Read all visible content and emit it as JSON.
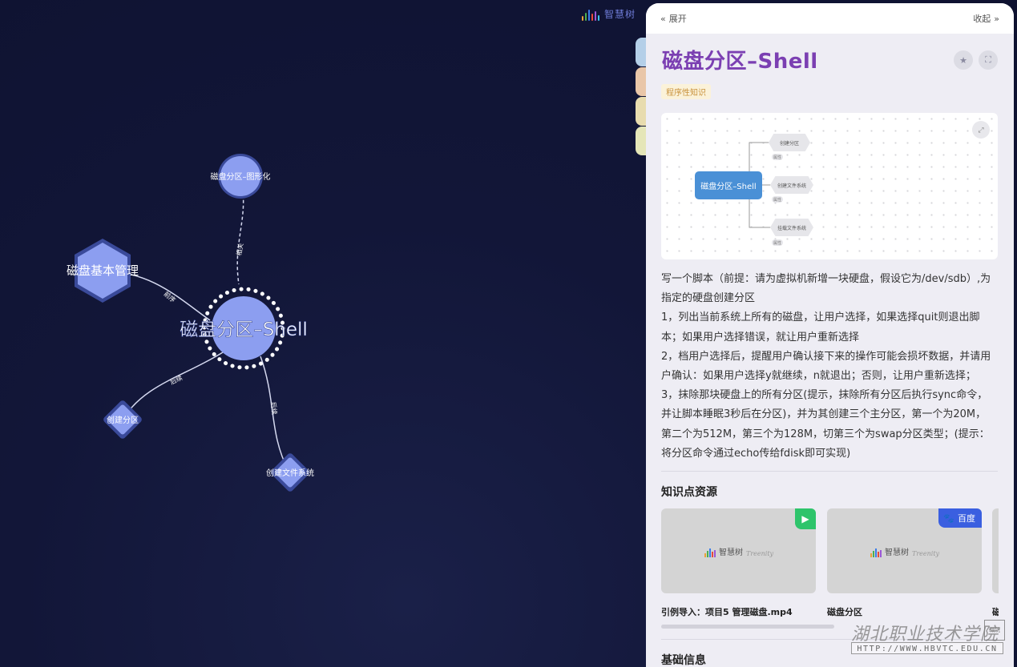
{
  "brand": {
    "logo_text": "智慧树"
  },
  "graph": {
    "center": {
      "label": "磁盘分区–Shell"
    },
    "nodes": [
      {
        "id": "gui",
        "label": "磁盘分区–图形化"
      },
      {
        "id": "basic",
        "label": "磁盘基本管理"
      },
      {
        "id": "create-part",
        "label": "创建分区"
      },
      {
        "id": "create-fs",
        "label": "创建文件系统"
      }
    ],
    "edge_labels": [
      "相关",
      "前序",
      "后续",
      "后续"
    ]
  },
  "panel": {
    "expand_label": "展开",
    "collapse_label": "收起",
    "title": "磁盘分区–Shell",
    "tag": "程序性知识",
    "mindmap": {
      "root": "磁盘分区–Shell",
      "children": [
        "创建分区",
        "创建文件系统",
        "挂载文件系统"
      ],
      "prop_label": "属性"
    },
    "description": [
      "写一个脚本（前提：请为虚拟机新增一块硬盘，假设它为/dev/sdb）,为指定的硬盘创建分区",
      "1，列出当前系统上所有的磁盘，让用户选择，如果选择quit则退出脚本；如果用户选择错误，就让用户重新选择",
      "2，档用户选择后，提醒用户确认接下来的操作可能会损坏数据，并请用户确认：如果用户选择y就继续，n就退出；否则，让用户重新选择；",
      "3，抹除那块硬盘上的所有分区(提示，抹除所有分区后执行sync命令，并让脚本睡眠3秒后在分区)，并为其创建三个主分区，第一个为20M，第二个为512M，第三个为128M，切第三个为swap分区类型；(提示：将分区命令通过echo传给fdisk即可实现)"
    ],
    "resources_title": "知识点资源",
    "resources": [
      {
        "caption": "引例导入：项目5 管理磁盘.mp4",
        "badge": "video",
        "thumb_logo": "智慧树",
        "thumb_sub": "Treenity"
      },
      {
        "caption": "磁盘分区",
        "badge": "百度",
        "thumb_logo": "智慧树",
        "thumb_sub": "Treenity"
      },
      {
        "caption": "磁"
      }
    ],
    "basic_info_title": "基础信息"
  },
  "watermark": {
    "name": "湖北职业技术学院",
    "url": "HTTP://WWW.HBVTC.EDU.CN",
    "seal": "職院"
  },
  "colors": {
    "node_fill": "#8c9ef0",
    "node_border": "#3a4a9a",
    "title_color": "#7b3fb2",
    "tag_bg": "#fbf2d9",
    "tag_text": "#c9923c",
    "side_tabs": [
      "#b4cfe8",
      "#e9c6a8",
      "#e8dcae",
      "#e5e6b8"
    ]
  }
}
